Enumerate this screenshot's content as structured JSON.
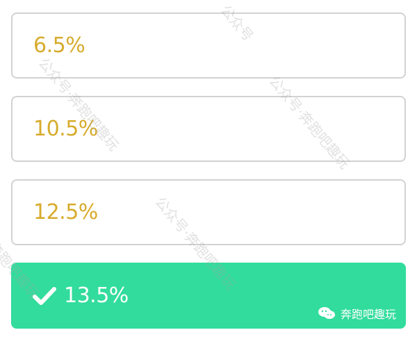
{
  "options": [
    {
      "label": "6.5%",
      "selected": false
    },
    {
      "label": "10.5%",
      "selected": false
    },
    {
      "label": "12.5%",
      "selected": false
    },
    {
      "label": "13.5%",
      "selected": true
    }
  ],
  "badge": {
    "text": "奔跑吧趣玩",
    "icon": "wechat-icon"
  },
  "colors": {
    "option_text": "#d7ab2c",
    "option_border": "#d2d2d2",
    "selected_bg": "#31dc9c",
    "selected_text": "#ffffff"
  },
  "icons": {
    "selected_check": "check-icon"
  }
}
